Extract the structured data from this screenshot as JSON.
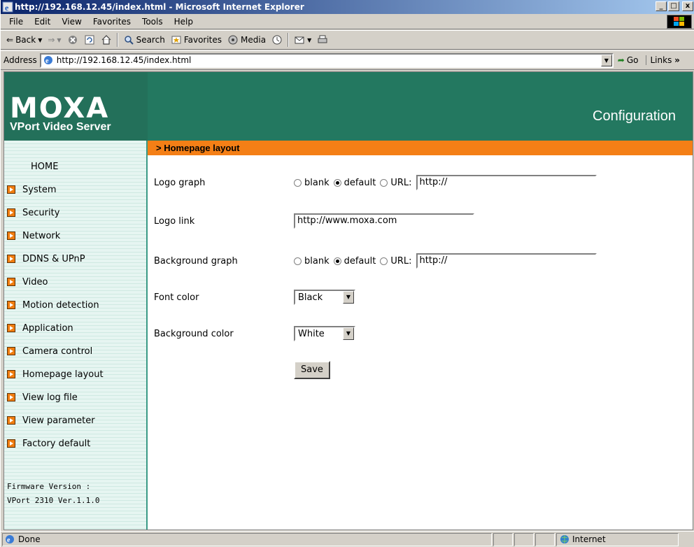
{
  "window": {
    "title": "http://192.168.12.45/index.html - Microsoft Internet Explorer",
    "min_btn": "_",
    "max_btn": "□",
    "close_btn": "x"
  },
  "menu": {
    "items": [
      "File",
      "Edit",
      "View",
      "Favorites",
      "Tools",
      "Help"
    ]
  },
  "toolbar": {
    "back": "Back",
    "search": "Search",
    "favorites": "Favorites",
    "media": "Media"
  },
  "address": {
    "label": "Address",
    "url": "http://192.168.12.45/index.html",
    "go": "Go",
    "links": "Links"
  },
  "banner": {
    "logo": "MOXA",
    "subtitle": "VPort Video Server",
    "section": "Configuration"
  },
  "sidebar": {
    "home": "HOME",
    "items": [
      {
        "label": "System"
      },
      {
        "label": "Security"
      },
      {
        "label": "Network"
      },
      {
        "label": "DDNS & UPnP"
      },
      {
        "label": "Video"
      },
      {
        "label": "Motion detection"
      },
      {
        "label": "Application"
      },
      {
        "label": "Camera control"
      },
      {
        "label": "Homepage layout"
      },
      {
        "label": "View log file"
      },
      {
        "label": "View parameter"
      },
      {
        "label": "Factory default"
      }
    ],
    "firmware_label": "Firmware Version :",
    "firmware_value": "VPort 2310 Ver.1.1.0"
  },
  "main": {
    "header": "> Homepage layout",
    "logo_graph": {
      "label": "Logo graph",
      "opt_blank": "blank",
      "opt_default": "default",
      "opt_url": "URL:",
      "url_value": "http://"
    },
    "logo_link": {
      "label": "Logo link",
      "value": "http://www.moxa.com"
    },
    "background_graph": {
      "label": "Background graph",
      "opt_blank": "blank",
      "opt_default": "default",
      "opt_url": "URL:",
      "url_value": "http://"
    },
    "font_color": {
      "label": "Font color",
      "value": "Black"
    },
    "background_color": {
      "label": "Background color",
      "value": "White"
    },
    "save_label": "Save"
  },
  "status": {
    "text": "Done",
    "zone": "Internet"
  },
  "colors": {
    "banner": "#237860",
    "header": "#f47f16",
    "sidebar": "#e6f5f1"
  }
}
